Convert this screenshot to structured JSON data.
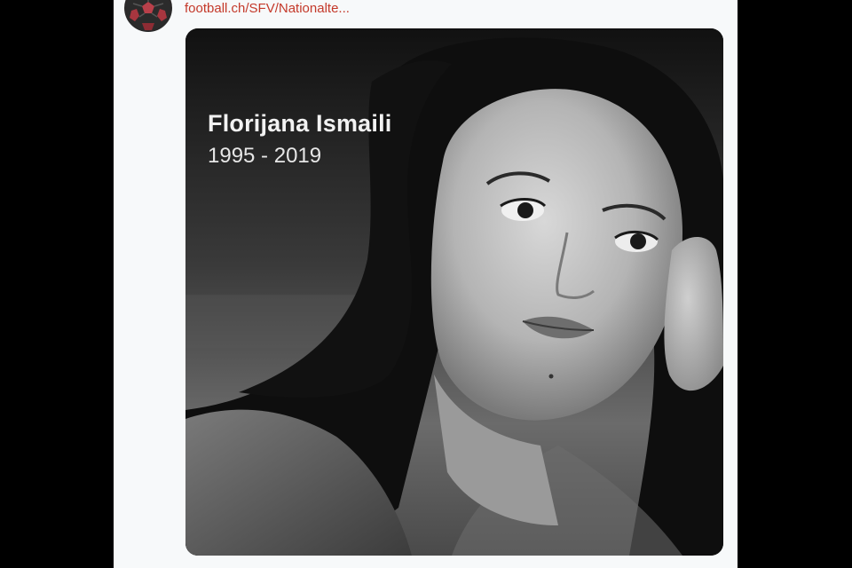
{
  "post": {
    "link_text": "football.ch/SFV/Nationalte...",
    "avatar_icon": "football-icon"
  },
  "media": {
    "name": "Florijana Ismaili",
    "years": "1995 - 2019"
  },
  "colors": {
    "link": "#c4392a",
    "post_background": "#f7f9fa",
    "page_background": "#000000"
  }
}
